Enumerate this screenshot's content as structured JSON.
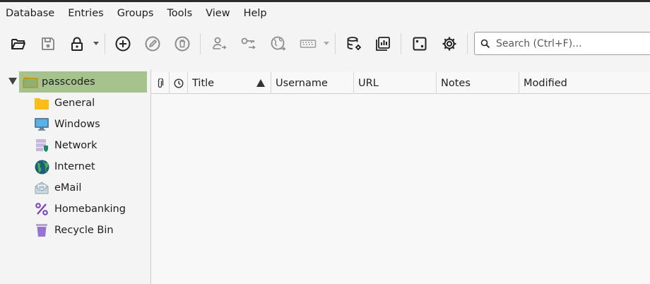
{
  "menubar": {
    "items": [
      "Database",
      "Entries",
      "Groups",
      "Tools",
      "View",
      "Help"
    ]
  },
  "toolbar": {
    "buttons": [
      {
        "name": "open-database",
        "icon": "folder-open-icon"
      },
      {
        "name": "save-database",
        "icon": "floppy-disk-icon"
      },
      {
        "name": "lock-database",
        "icon": "padlock-icon"
      },
      {
        "name": "new-entry",
        "icon": "plus-circle-icon"
      },
      {
        "name": "edit-entry",
        "icon": "pencil-circle-icon"
      },
      {
        "name": "delete-entry",
        "icon": "trash-circle-icon"
      },
      {
        "name": "copy-username",
        "icon": "user-arrow-icon"
      },
      {
        "name": "copy-password",
        "icon": "key-arrow-icon"
      },
      {
        "name": "copy-url",
        "icon": "globe-arrow-icon"
      },
      {
        "name": "autotype",
        "icon": "keyboard-icon"
      },
      {
        "name": "database-settings",
        "icon": "database-gear-icon"
      },
      {
        "name": "reports",
        "icon": "reports-icon"
      },
      {
        "name": "password-generator",
        "icon": "dice-icon"
      },
      {
        "name": "settings",
        "icon": "gear-icon"
      }
    ]
  },
  "search": {
    "placeholder": "Search (Ctrl+F)..."
  },
  "groups": {
    "root": {
      "label": "passcodes",
      "icon": "folder-icon"
    },
    "items": [
      {
        "label": "General",
        "icon": "folder-icon"
      },
      {
        "label": "Windows",
        "icon": "monitor-icon"
      },
      {
        "label": "Network",
        "icon": "network-server-icon"
      },
      {
        "label": "Internet",
        "icon": "globe-icon"
      },
      {
        "label": "eMail",
        "icon": "envelope-icon"
      },
      {
        "label": "Homebanking",
        "icon": "percent-icon"
      },
      {
        "label": "Recycle Bin",
        "icon": "recycle-bin-icon"
      }
    ]
  },
  "entries_table": {
    "columns": [
      "Title",
      "Username",
      "URL",
      "Notes",
      "Modified"
    ],
    "sorted_by": "Title",
    "sort_direction": "ascending",
    "rows": []
  },
  "colors": {
    "selected_group": "#a6c38e",
    "folder": "#fcbc19",
    "accent_purple": "#7a3fb0"
  }
}
